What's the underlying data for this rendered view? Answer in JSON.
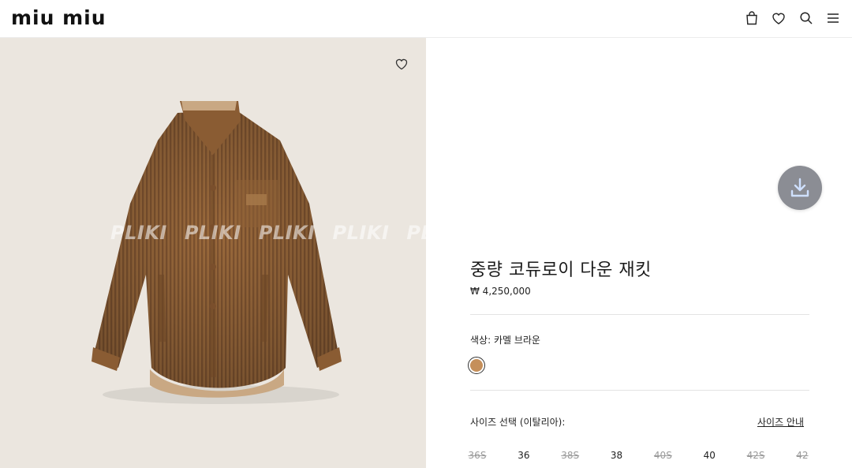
{
  "header": {
    "logo": "miu miu",
    "icons": [
      "bag-icon",
      "heart-icon",
      "search-icon",
      "menu-icon"
    ]
  },
  "image": {
    "watermark": [
      "PLIKI",
      "PLIKI",
      "PLIKI",
      "PLIKI",
      "PLIKI"
    ],
    "wishlist_icon": "heart-icon"
  },
  "download": {
    "icon": "download-icon"
  },
  "product": {
    "title": "중량 코듀로이 다운 재킷",
    "price": "₩ 4,250,000",
    "color_label": "색상:  카멜 브라운",
    "color_hex": "#c58f5a",
    "size_label": "사이즈 선택 (이탈리아):",
    "size_guide": "사이즈 안내",
    "sizes": [
      {
        "label": "36S",
        "available": false
      },
      {
        "label": "36",
        "available": true
      },
      {
        "label": "38S",
        "available": false
      },
      {
        "label": "38",
        "available": true
      },
      {
        "label": "40S",
        "available": false
      },
      {
        "label": "40",
        "available": true
      },
      {
        "label": "42S",
        "available": false
      },
      {
        "label": "42",
        "available": false
      }
    ]
  }
}
